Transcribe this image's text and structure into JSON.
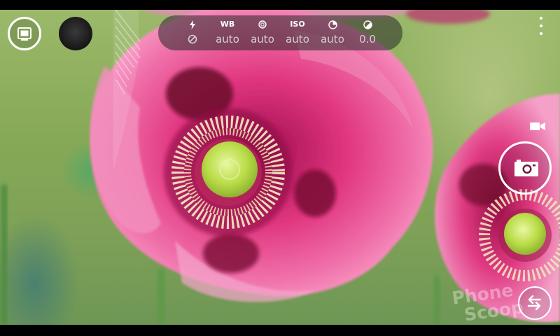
{
  "top_left": {
    "lens_icon": "lenses-icon",
    "gallery_icon": "camera-roll-thumbnail"
  },
  "settings": [
    {
      "id": "flash",
      "icon": "flash-icon",
      "value_icon": "flash-off-icon",
      "value": ""
    },
    {
      "id": "wb",
      "label": "WB",
      "value": "auto"
    },
    {
      "id": "focus",
      "icon": "focus-icon",
      "value": "auto"
    },
    {
      "id": "iso",
      "label": "ISO",
      "value": "auto"
    },
    {
      "id": "shutter",
      "icon": "shutter-speed-icon",
      "value": "auto"
    },
    {
      "id": "exposure",
      "icon": "exposure-icon",
      "value": "0.0"
    }
  ],
  "right_controls": {
    "more_icon": "more-options-icon",
    "video_icon": "video-mode-icon",
    "shutter_icon": "camera-shutter-icon",
    "switch_icon": "switch-arrows-icon"
  },
  "watermark": {
    "line1": "Phone",
    "line2": "Scoop"
  },
  "colors": {
    "ui_white": "#ffffff",
    "settings_value": "#d0d0d0",
    "settings_bar_bg": "rgba(40,40,40,0.55)"
  }
}
